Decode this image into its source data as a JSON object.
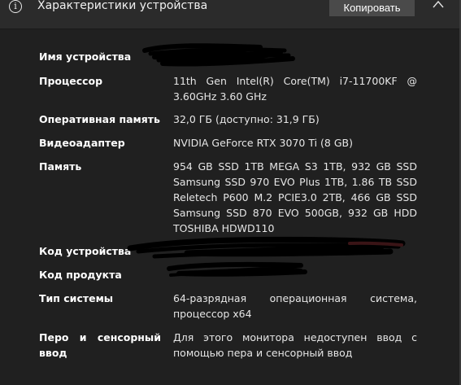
{
  "header": {
    "icon": "info-icon",
    "icon_glyph": "i",
    "title": "Характеристики устройства",
    "copy_label": "Копировать",
    "collapse_icon": "chevron-up-icon"
  },
  "specs": {
    "device_name": {
      "label": "Имя устройства",
      "value": ""
    },
    "processor": {
      "label": "Процессор",
      "lines": [
        "11th Gen Intel(R) Core(TM) i7-11700KF @",
        "3.60GHz 3.60 GHz"
      ]
    },
    "ram": {
      "label": "Оперативная память",
      "value": "32,0 ГБ (доступно: 31,9 ГБ)"
    },
    "video": {
      "label": "Видеоадаптер",
      "value": "NVIDIA GeForce RTX 3070 Ti (8 GB)"
    },
    "storage": {
      "label": "Память",
      "lines": [
        "954 GB SSD 1TB MEGA S3 1TB, 932 GB SSD",
        "Samsung SSD 970 EVO Plus 1TB, 1.86 TB SSD",
        "Reletech P600 M.2 PCIE3.0 2TB, 466 GB SSD",
        "Samsung SSD 870 EVO 500GB, 932 GB HDD",
        "TOSHIBA HDWD110"
      ]
    },
    "device_id": {
      "label": "Код устройства",
      "value": ""
    },
    "product_id": {
      "label": "Код продукта",
      "value": ""
    },
    "system_type": {
      "label": "Тип системы",
      "lines": [
        "64-разрядная операционная система,",
        "процессор x64"
      ]
    },
    "pen_touch": {
      "label_lines": [
        "Перо и сенсорный",
        "ввод"
      ],
      "lines": [
        "Для этого монитора недоступен ввод с",
        "помощью пера и сенсорный ввод"
      ]
    }
  },
  "colors": {
    "background": "#202020",
    "header": "#2b2b2b",
    "button": "#4a4a4a",
    "text": "#ffffff",
    "redaction": "#000000"
  }
}
